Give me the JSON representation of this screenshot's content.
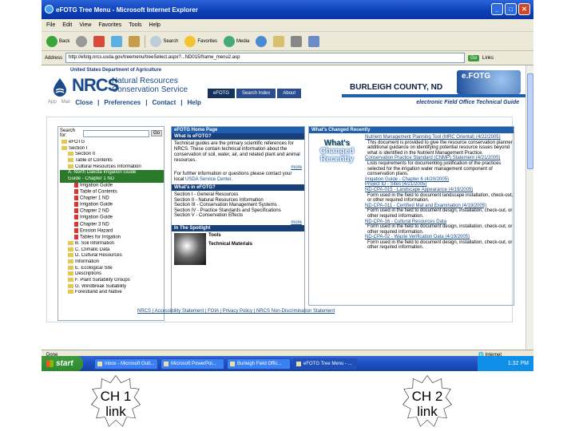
{
  "window": {
    "title": "eFOTG Tree Menu - Microsoft Internet Explorer",
    "minimize": "_",
    "maximize": "□",
    "close": "✕"
  },
  "menubar": [
    "File",
    "Edit",
    "View",
    "Favorites",
    "Tools",
    "Help"
  ],
  "toolbar": {
    "back": "Back",
    "search": "Search",
    "favorites": "Favorites",
    "media": "Media"
  },
  "address": {
    "label": "Address",
    "url": "http://efotg.nrcs.usda.gov/treemenu/treeSelect.aspx?...ND015/frame_menu2.asp",
    "go": "Go",
    "links": "Links"
  },
  "page": {
    "usda": "United States Department of Agriculture",
    "nrcs": "NRCS",
    "nrcs_sub1": "Natural Resources",
    "nrcs_sub2": "Conservation Service",
    "tabs": [
      "eFOTG",
      "Search Index",
      "About"
    ],
    "county": "BURLEIGH COUNTY, ND",
    "efotg_logo": "e.FOTG",
    "app_label": "App",
    "links_prefix": "Man",
    "links": [
      "Close",
      "Preferences",
      "Contact",
      "Help"
    ],
    "tagline": "electronic Field Office Technical Guide",
    "search_label": "Search for:",
    "search_go": "Go",
    "tree_label": "eFOTG",
    "tree": [
      {
        "t": "eFOTG",
        "k": "fold"
      },
      {
        "t": "Section I",
        "k": "fold"
      },
      {
        "t": "Section II",
        "k": "fold"
      },
      {
        "t": "Table of Contents",
        "k": "fold"
      },
      {
        "t": "Cultural Resources Information",
        "k": "fold"
      },
      {
        "t": "A. North Dakota Irrigation Guide",
        "k": "hl"
      },
      {
        "t": "Guide - Chapter 1 ND",
        "k": "hl"
      },
      {
        "t": "Irrigation Guide",
        "k": "pdf"
      },
      {
        "t": "Table of Contents",
        "k": "pdf"
      },
      {
        "t": "Chapter 1 ND",
        "k": "pdf"
      },
      {
        "t": "Irrigation Guide",
        "k": "pdf"
      },
      {
        "t": "Chapter 2 ND",
        "k": "pdf"
      },
      {
        "t": "Irrigation Guide",
        "k": "pdf"
      },
      {
        "t": "Chapter 3 ND",
        "k": "pdf"
      },
      {
        "t": "Erosion Hazard",
        "k": "pdf"
      },
      {
        "t": "Tables for Irrigation",
        "k": "pdf"
      },
      {
        "t": "B. Soil Information",
        "k": "fold"
      },
      {
        "t": "C. Climatic Data",
        "k": "fold"
      },
      {
        "t": "D. Cultural Resources",
        "k": "fold"
      },
      {
        "t": "Information",
        "k": "fold"
      },
      {
        "t": "E. Ecological Site",
        "k": "fold"
      },
      {
        "t": "Descriptions",
        "k": "fold"
      },
      {
        "t": "F. Plant Suitability Groups",
        "k": "fold"
      },
      {
        "t": "G. Windbreak Suitability",
        "k": "fold"
      },
      {
        "t": "Forestland and Native",
        "k": "fold"
      }
    ],
    "home_hdr": "eFOTG Home Page",
    "what_hdr": "What is eFOTG?",
    "what_text": "Technical guides are the primary scientific references for NRCS. These contain technical information about the conservation of soil, water, air, and related plant and animal resources.",
    "more": "more",
    "info_text": "For further information or questions please contact your local",
    "info_link": "USDA Service Center.",
    "inside_hdr": "What's in eFOTG?",
    "inside_list": [
      "Section I - General Resources",
      "Section II - Natural Resources Information",
      "Section III - Conservation Management Systems",
      "Section IV - Practice Standards and Specifications",
      "Section V - Conservation Effects"
    ],
    "spot_hdr": "In The Spotlight",
    "spot_tools": "Tools",
    "spot_materials": "Technical Materials",
    "spot_img": "in the Spotlight",
    "changed_hdr": "What's Changed Recently",
    "wcr": [
      "What's",
      "Changed",
      "Recently"
    ],
    "changed_items": [
      {
        "link": "Nutrient Management Planning Tool (MRC Oriental) (4/22/2005)",
        "text": "This document is provided to give the resource conservation planner additional guidance on identifying potential resource issues beyond what is identified in the Nutrient Management Practice."
      },
      {
        "link": "Conservation Practice Standard (CNMP) Statement (4/21/2005)",
        "text": "Lists requirements for documenting justification of the practices selected for the irrigation water management component of conservation plans."
      },
      {
        "link": "Irrigation Guide - Chapter 6 (4/20/2005)",
        "text": ""
      },
      {
        "link": "Project ID - Sites (4/21/2005)",
        "text": ""
      },
      {
        "link": "ND-CPA-015 - Landscape Appearance (4/19/2005)",
        "text": "Form used in the field to document landscape installation, check-out, or other required information."
      },
      {
        "link": "ND-CPA-011 - Certified Mat and Examination (4/19/2005)",
        "text": "Form used in the field to document design, installation, check-out, or other required information."
      },
      {
        "link": "ND-CPA-16 - Cultural Resources Data",
        "text": "Form used in the field to document design, installation, check-out, or other required information."
      },
      {
        "link": "ND-CPA-02 - Waste Verification Data (4/19/2005)",
        "text": "Form used in the field to document design, installation, check-out, or other required information."
      }
    ],
    "footer": "NRCS | Accessibility Statement | FOIA | Privacy Policy | NRCS Non-Discrimination Statement"
  },
  "status": {
    "done": "Done",
    "zone": "Internet"
  },
  "taskbar": {
    "start": "start",
    "tasks": [
      "Inbox - Microsoft Outl...",
      "Microsoft PowerPoi...",
      "Burleigh Field Offic...",
      "eFOTG Tree Menu - ..."
    ],
    "time": "1:32 PM"
  },
  "callouts": [
    {
      "line1": "CH 1",
      "line2": "link"
    },
    {
      "line1": "CH 2",
      "line2": "link"
    }
  ]
}
